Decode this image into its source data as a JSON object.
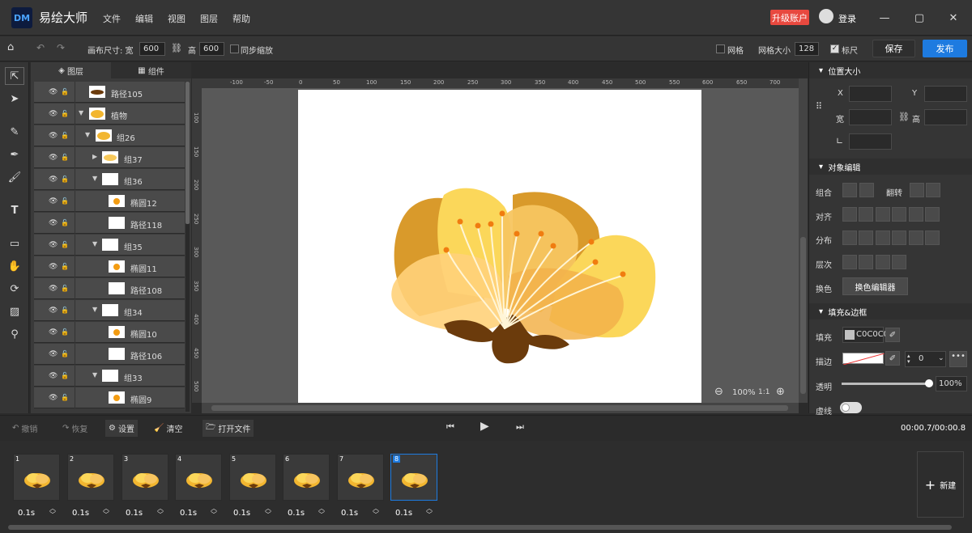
{
  "app": {
    "logo": "DM",
    "name": "易绘大师"
  },
  "menu": [
    "文件",
    "编辑",
    "视图",
    "图层",
    "帮助"
  ],
  "header": {
    "upgrade_label": "升级账户",
    "login_label": "登录"
  },
  "toolbar": {
    "canvas_size_label": "画布尺寸: 宽",
    "width_value": "600",
    "height_label": "高",
    "height_value": "600",
    "sync_zoom_label": "同步缩放",
    "grid_label": "网格",
    "grid_size_label": "网格大小",
    "grid_size_value": "128",
    "ruler_label": "标尺",
    "save_label": "保存",
    "publish_label": "发布"
  },
  "layers_panel": {
    "tabs": [
      "图层",
      "组件"
    ],
    "rows": [
      "路径105",
      "植物",
      "组26",
      "组37",
      "组36",
      "椭圆12",
      "路径118",
      "组35",
      "椭圆11",
      "路径108",
      "组34",
      "椭圆10",
      "路径106",
      "组33",
      "椭圆9"
    ]
  },
  "ruler": {
    "h_ticks": [
      "-100",
      "-50",
      "0",
      "50",
      "100",
      "150",
      "200",
      "250",
      "300",
      "350",
      "400",
      "450",
      "500",
      "550",
      "600",
      "650",
      "700"
    ],
    "v_ticks": [
      "100",
      "150",
      "200",
      "250",
      "300",
      "350",
      "400",
      "450",
      "500"
    ]
  },
  "zoom": {
    "value": "100%",
    "ratio": "1:1"
  },
  "right_panel": {
    "position_size": {
      "title": "位置大小",
      "x_label": "X",
      "y_label": "Y",
      "width_label": "宽",
      "height_label": "高"
    },
    "object_edit": {
      "title": "对象编辑",
      "group_label": "组合",
      "flip_label": "翻转",
      "align_label": "对齐",
      "distribute_label": "分布",
      "layer_order_label": "层次",
      "swap_color_label": "换色",
      "color_editor_label": "换色编辑器"
    },
    "fill_stroke": {
      "title": "填充&边框",
      "fill_label": "填充",
      "fill_value": "C0C0C0",
      "stroke_label": "描边",
      "stroke_width": "0",
      "opacity_label": "透明",
      "opacity_value": "100%",
      "dash_label": "虚线",
      "opacity_fraction": 1.0
    }
  },
  "bottom_bar": {
    "undo_label": "撤销",
    "redo_label": "恢复",
    "settings_label": "设置",
    "clear_label": "清空",
    "open_file_label": "打开文件",
    "time_display": "00:00.7/00:00.8"
  },
  "timeline": {
    "frames": [
      {
        "num": "1",
        "duration": "0.1s"
      },
      {
        "num": "2",
        "duration": "0.1s"
      },
      {
        "num": "3",
        "duration": "0.1s"
      },
      {
        "num": "4",
        "duration": "0.1s"
      },
      {
        "num": "5",
        "duration": "0.1s"
      },
      {
        "num": "6",
        "duration": "0.1s"
      },
      {
        "num": "7",
        "duration": "0.1s"
      },
      {
        "num": "8",
        "duration": "0.1s"
      }
    ],
    "selected_frame": "8",
    "new_label": "新建"
  },
  "colors": {
    "accent": "#1e7be0",
    "upgrade": "#e8493f",
    "fill_swatch": "#C0C0C0"
  }
}
